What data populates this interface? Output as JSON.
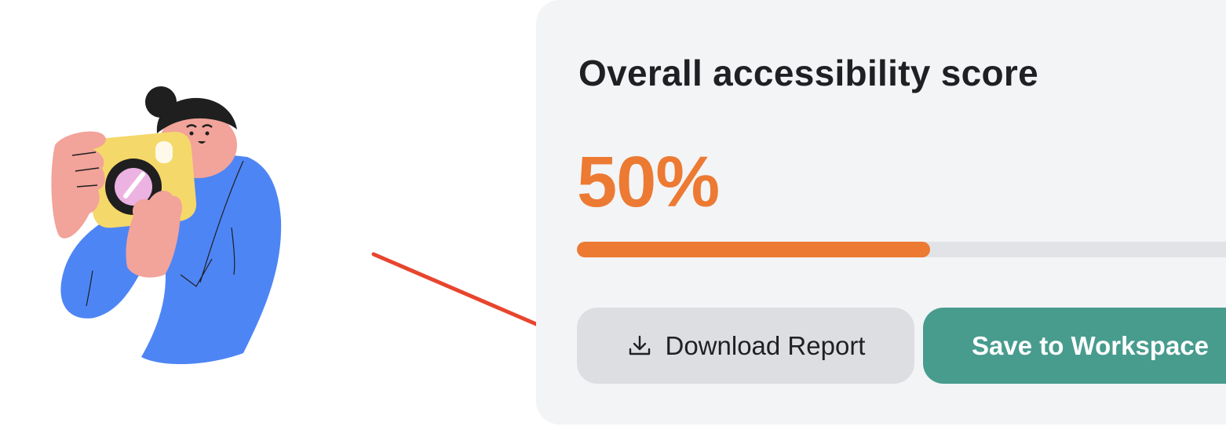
{
  "illustration": {
    "icon": "person-with-camera-illustration"
  },
  "annotation": {
    "icon": "red-arrow-pointer",
    "color": "#e8452e"
  },
  "score_card": {
    "title": "Overall accessibility score",
    "score_label": "50%",
    "progress_fraction": 0.5,
    "accent_color": "#ec7a33",
    "track_color": "#e2e3e6"
  },
  "actions": {
    "download_label": "Download Report",
    "download_icon": "download-icon",
    "save_label": "Save to Workspace",
    "save_color": "#479c8e"
  }
}
